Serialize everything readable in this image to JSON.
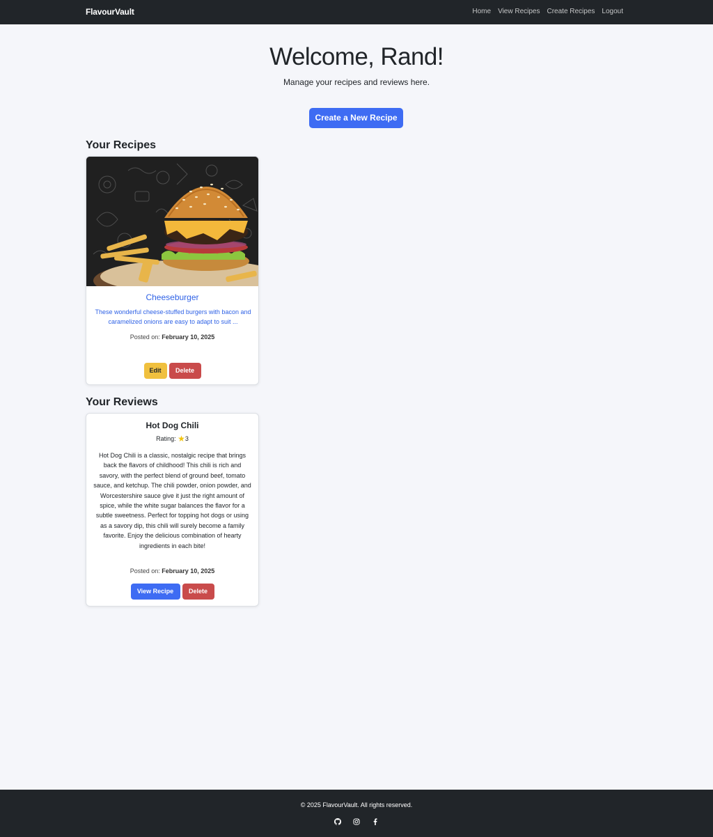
{
  "navbar": {
    "brand": "FlavourVault",
    "links": [
      "Home",
      "View Recipes",
      "Create Recipes",
      "Logout"
    ]
  },
  "hero": {
    "title": "Welcome, Rand!",
    "subtitle": "Manage your recipes and reviews here.",
    "create_button": "Create a New Recipe"
  },
  "recipes_section": {
    "heading": "Your Recipes",
    "items": [
      {
        "title": "Cheeseburger",
        "image": "cheeseburger-photo",
        "description": "These wonderful cheese-stuffed burgers with bacon and caramelized onions are easy to adapt to suit ...",
        "posted_label": "Posted on:",
        "posted_date": "February 10, 2025",
        "edit_label": "Edit",
        "delete_label": "Delete"
      }
    ]
  },
  "reviews_section": {
    "heading": "Your Reviews",
    "items": [
      {
        "title": "Hot Dog Chili",
        "rating_label": "Rating:",
        "rating_icon": "star-icon",
        "rating_value": "3",
        "text": "Hot Dog Chili is a classic, nostalgic recipe that brings back the flavors of childhood! This chili is rich and savory, with the perfect blend of ground beef, tomato sauce, and ketchup. The chili powder, onion powder, and Worcestershire sauce give it just the right amount of spice, while the white sugar balances the flavor for a subtle sweetness. Perfect for topping hot dogs or using as a savory dip, this chili will surely become a family favorite. Enjoy the delicious combination of hearty ingredients in each bite!",
        "posted_label": "Posted on:",
        "posted_date": "February 10, 2025",
        "view_label": "View Recipe",
        "delete_label": "Delete"
      }
    ]
  },
  "footer": {
    "copyright": "© 2025 FlavourVault. All rights reserved.",
    "social_icons": [
      "github-icon",
      "instagram-icon",
      "facebook-icon"
    ]
  },
  "colors": {
    "navbar_bg": "#212529",
    "page_bg": "#f5f6fa",
    "primary": "#3e6cf3",
    "link": "#2f62e6",
    "warning": "#f0c03e",
    "danger": "#c94b4b"
  }
}
